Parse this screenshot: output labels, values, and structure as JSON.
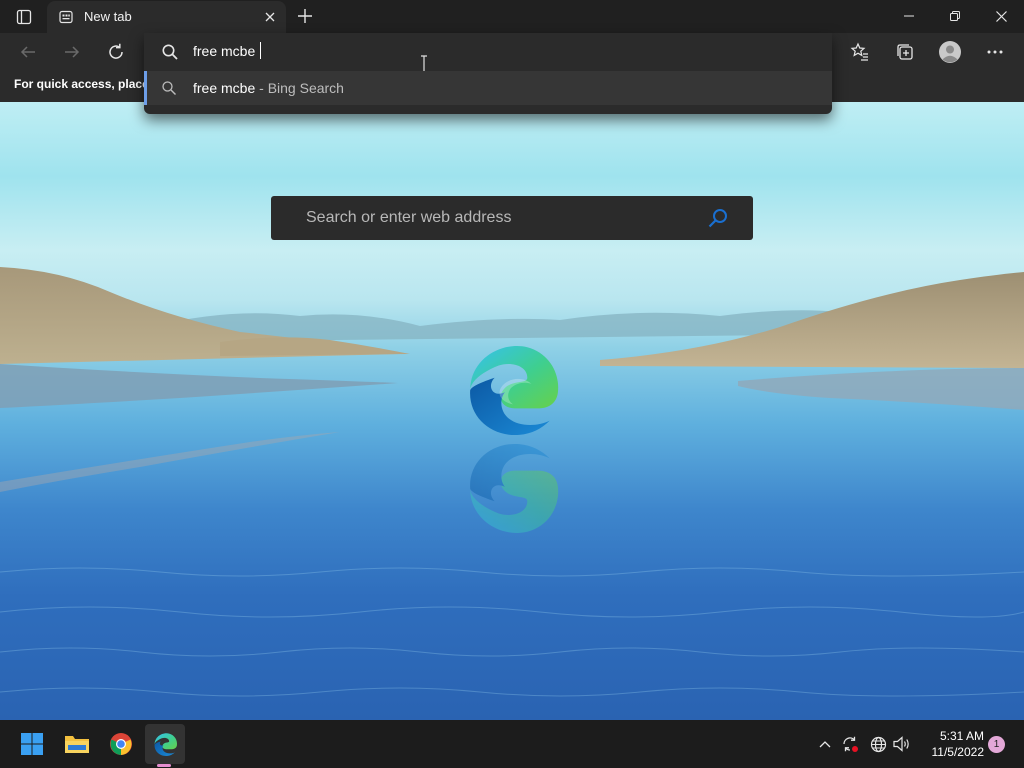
{
  "browser": {
    "tab": {
      "title": "New tab"
    },
    "address_bar": {
      "value": "free mcbe ",
      "suggestions": [
        {
          "query": "free mcbe",
          "source": " - Bing Search"
        }
      ]
    },
    "favorites_bar": {
      "text": "For quick access, place y"
    }
  },
  "new_tab_page": {
    "search_placeholder": "Search or enter web address"
  },
  "taskbar": {
    "apps": [
      "start-icon",
      "file-explorer-icon",
      "chrome-icon",
      "edge-icon"
    ],
    "clock": {
      "time": "5:31 AM",
      "date": "11/5/2022"
    },
    "notification_count": "1"
  },
  "colors": {
    "accent": "#6d9ee8",
    "toolbar": "#2b2b2b",
    "tabstrip": "#202020",
    "taskbar": "#1c1c1c"
  }
}
